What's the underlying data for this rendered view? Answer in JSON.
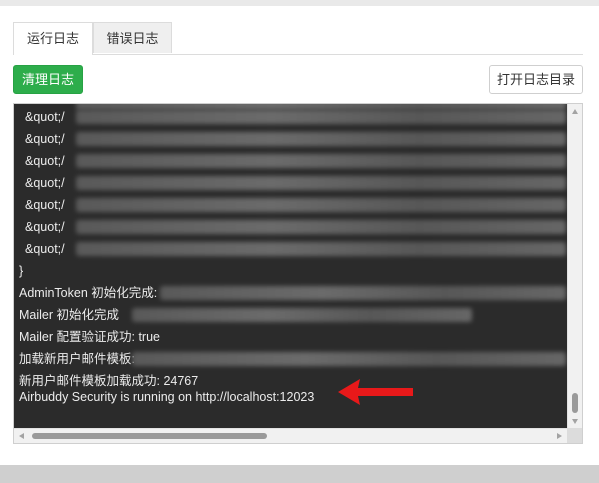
{
  "tabs": [
    {
      "label": "运行日志",
      "active": true
    },
    {
      "label": "错误日志",
      "active": false
    }
  ],
  "toolbar": {
    "clear_label": "清理日志",
    "open_dir_label": "打开日志目录"
  },
  "log": {
    "quot_lines": [
      "&quot;/",
      "&quot;/",
      "&quot;/",
      "&quot;/",
      "&quot;/",
      "&quot;/",
      "&quot;/"
    ],
    "closing_brace": "}",
    "admin_token": "AdminToken 初始化完成:",
    "mailer_init": "Mailer 初始化完成",
    "mailer_verify": "Mailer 配置验证成功: true",
    "template_loading": "加载新用户邮件模板:",
    "template_loaded": "新用户邮件模板加载成功: 24767",
    "running": "Airbuddy Security is running on http://localhost:12023"
  },
  "colors": {
    "accent_green": "#2dad4b",
    "log_background": "#2b2b2b",
    "annotation_arrow": "#e8191a"
  },
  "icons": [
    "scroll-up-arrow-icon",
    "scroll-down-arrow-icon",
    "scroll-left-arrow-icon",
    "scroll-right-arrow-icon",
    "red-pointer-arrow-icon"
  ]
}
